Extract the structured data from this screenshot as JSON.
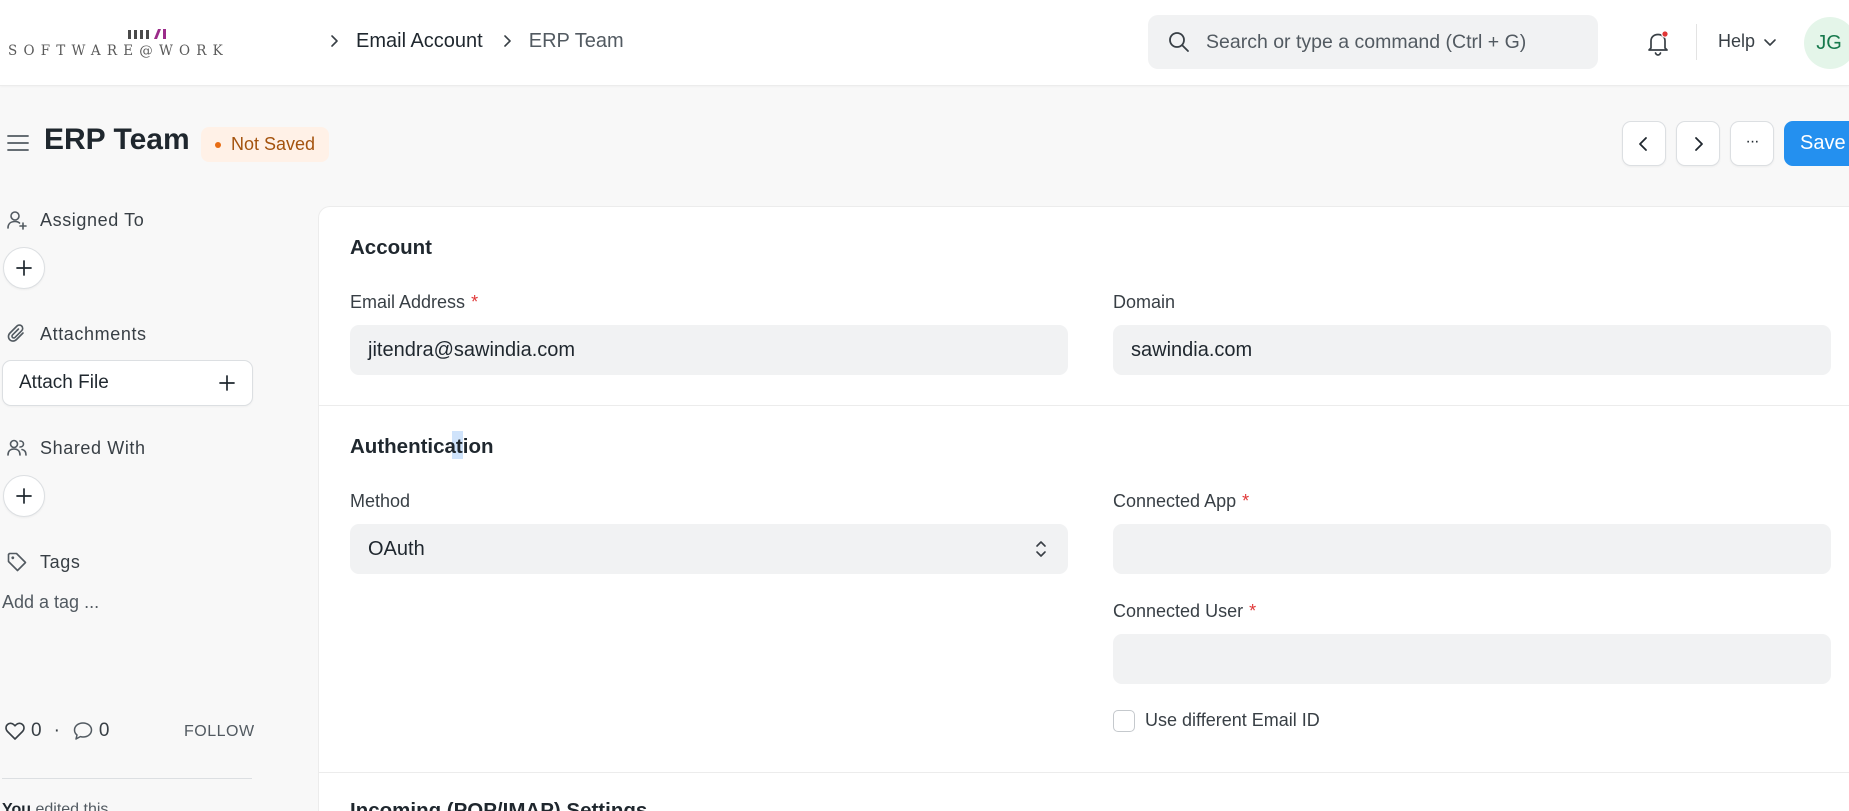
{
  "navbar": {
    "logo_text": "SOFTWARE@WORK",
    "breadcrumbs": [
      "Email Account",
      "ERP Team"
    ],
    "search_placeholder": "Search or type a command (Ctrl + G)",
    "help_label": "Help",
    "avatar_initials": "JG"
  },
  "page": {
    "title": "ERP Team",
    "status": "Not Saved",
    "save_label": "Save",
    "more_label": "···"
  },
  "sidebar": {
    "assigned_to": "Assigned To",
    "attachments": "Attachments",
    "attach_file": "Attach File",
    "shared_with": "Shared With",
    "tags": "Tags",
    "add_tag": "Add a tag ...",
    "likes": "0",
    "comments": "0",
    "separator": "·",
    "follow": "FOLLOW",
    "activity_user": "You",
    "activity_text": "edited this"
  },
  "form": {
    "account": {
      "heading": "Account",
      "email_label": "Email Address",
      "email_value": "jitendra@sawindia.com",
      "domain_label": "Domain",
      "domain_value": "sawindia.com"
    },
    "authentication": {
      "heading": "Authentication",
      "method_label": "Method",
      "method_value": "OAuth",
      "connected_app_label": "Connected App",
      "connected_app_value": "",
      "connected_user_label": "Connected User",
      "connected_user_value": "",
      "use_different_email_label": "Use different Email ID",
      "use_different_email_checked": false
    },
    "incoming": {
      "heading": "Incoming (POP/IMAP) Settings"
    },
    "required_mark": "*"
  },
  "colors": {
    "primary": "#2490ef",
    "status_bg": "#fff1e7",
    "status_text": "#a4530e",
    "status_dot": "#e86c13",
    "avatar_bg": "#e4f5e9",
    "avatar_text": "#16794c",
    "required": "#e03636",
    "logo_accent": "#9b2b8a"
  },
  "icons": {
    "chevron": "chevron-right-icon",
    "search": "search-icon",
    "bell": "bell-icon",
    "menu": "hamburger-icon",
    "prev": "chevron-left-icon",
    "next": "chevron-right-icon",
    "assign": "user-plus-icon",
    "attach": "paperclip-icon",
    "shared": "users-icon",
    "tags": "tag-icon",
    "like": "heart-icon",
    "comment": "comment-icon",
    "select": "select-arrows-icon"
  }
}
